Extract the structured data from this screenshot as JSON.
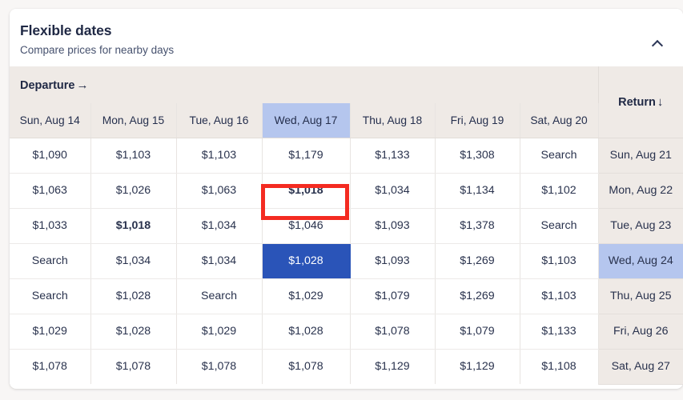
{
  "card": {
    "title": "Flexible dates",
    "subtitle": "Compare prices for nearby days",
    "collapse_icon": "chevron-up-icon",
    "collapse_label": ""
  },
  "grid": {
    "departure_label": "Departure",
    "departure_arrow": "→",
    "return_label": "Return",
    "return_arrow": "↓",
    "departure_days": [
      "Sun, Aug 14",
      "Mon, Aug 15",
      "Tue, Aug 16",
      "Wed, Aug 17",
      "Thu, Aug 18",
      "Fri, Aug 19",
      "Sat, Aug 20"
    ],
    "selected_departure": "Wed, Aug 17",
    "selected_return": "Wed, Aug 24",
    "search_label": "Search",
    "rows": [
      {
        "return_day": "Sun, Aug 21",
        "return_selected": false,
        "cells": [
          {
            "text": "$1,090",
            "style": "normal"
          },
          {
            "text": "$1,103",
            "style": "normal"
          },
          {
            "text": "$1,103",
            "style": "normal"
          },
          {
            "text": "$1,179",
            "style": "normal"
          },
          {
            "text": "$1,133",
            "style": "normal"
          },
          {
            "text": "$1,308",
            "style": "normal"
          },
          {
            "text": "Search",
            "style": "search"
          }
        ]
      },
      {
        "return_day": "Mon, Aug 22",
        "return_selected": false,
        "cells": [
          {
            "text": "$1,063",
            "style": "normal"
          },
          {
            "text": "$1,026",
            "style": "normal"
          },
          {
            "text": "$1,063",
            "style": "normal"
          },
          {
            "text": "$1,018",
            "style": "green"
          },
          {
            "text": "$1,034",
            "style": "normal"
          },
          {
            "text": "$1,134",
            "style": "normal"
          },
          {
            "text": "$1,102",
            "style": "normal"
          }
        ]
      },
      {
        "return_day": "Tue, Aug 23",
        "return_selected": false,
        "cells": [
          {
            "text": "$1,033",
            "style": "normal"
          },
          {
            "text": "$1,018",
            "style": "green"
          },
          {
            "text": "$1,034",
            "style": "normal"
          },
          {
            "text": "$1,046",
            "style": "normal"
          },
          {
            "text": "$1,093",
            "style": "normal"
          },
          {
            "text": "$1,378",
            "style": "red"
          },
          {
            "text": "Search",
            "style": "search"
          }
        ]
      },
      {
        "return_day": "Wed, Aug 24",
        "return_selected": true,
        "cells": [
          {
            "text": "Search",
            "style": "search"
          },
          {
            "text": "$1,034",
            "style": "normal"
          },
          {
            "text": "$1,034",
            "style": "normal"
          },
          {
            "text": "$1,028",
            "style": "selected"
          },
          {
            "text": "$1,093",
            "style": "normal"
          },
          {
            "text": "$1,269",
            "style": "normal"
          },
          {
            "text": "$1,103",
            "style": "normal"
          }
        ]
      },
      {
        "return_day": "Thu, Aug 25",
        "return_selected": false,
        "cells": [
          {
            "text": "Search",
            "style": "search"
          },
          {
            "text": "$1,028",
            "style": "normal"
          },
          {
            "text": "Search",
            "style": "search"
          },
          {
            "text": "$1,029",
            "style": "normal"
          },
          {
            "text": "$1,079",
            "style": "normal"
          },
          {
            "text": "$1,269",
            "style": "normal"
          },
          {
            "text": "$1,103",
            "style": "normal"
          }
        ]
      },
      {
        "return_day": "Fri, Aug 26",
        "return_selected": false,
        "cells": [
          {
            "text": "$1,029",
            "style": "normal"
          },
          {
            "text": "$1,028",
            "style": "normal"
          },
          {
            "text": "$1,029",
            "style": "normal"
          },
          {
            "text": "$1,028",
            "style": "normal"
          },
          {
            "text": "$1,078",
            "style": "normal"
          },
          {
            "text": "$1,079",
            "style": "normal"
          },
          {
            "text": "$1,133",
            "style": "normal"
          }
        ]
      },
      {
        "return_day": "Sat, Aug 27",
        "return_selected": false,
        "cells": [
          {
            "text": "$1,078",
            "style": "normal"
          },
          {
            "text": "$1,078",
            "style": "normal"
          },
          {
            "text": "$1,078",
            "style": "normal"
          },
          {
            "text": "$1,078",
            "style": "normal"
          },
          {
            "text": "$1,129",
            "style": "normal"
          },
          {
            "text": "$1,129",
            "style": "normal"
          },
          {
            "text": "$1,108",
            "style": "normal"
          }
        ]
      }
    ],
    "annotation": {
      "type": "red-highlight-box",
      "target_cell": "$1,018",
      "color": "#f42b21"
    }
  },
  "colors": {
    "accent_blue": "#2a54b8",
    "link_blue": "#4a7ef0",
    "cheap_green": "#0e7f6e",
    "expensive_red": "#f3483a",
    "header_beige": "#efeae6",
    "selected_light_blue": "#b5c6ee"
  }
}
